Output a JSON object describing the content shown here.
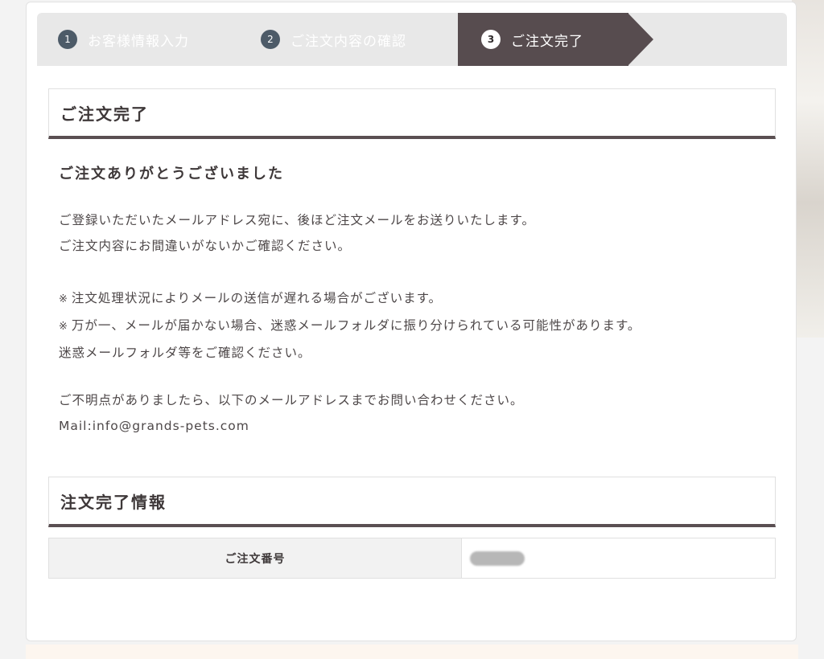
{
  "stepper": {
    "steps": [
      {
        "num": "1",
        "label": "お客様情報入力"
      },
      {
        "num": "2",
        "label": "ご注文内容の確認"
      },
      {
        "num": "3",
        "label": "ご注文完了"
      }
    ]
  },
  "complete_section": {
    "title": "ご注文完了",
    "thanks": "ご注文ありがとうございました",
    "lines": [
      "ご登録いただいたメールアドレス宛に、後ほど注文メールをお送りいたします。",
      "ご注文内容にお間違いがないかご確認ください。"
    ],
    "note_mark": "※",
    "notes": [
      "注文処理状況によりメールの送信が遅れる場合がございます。",
      "万が一、メールが届かない場合、迷惑メールフォルダに振り分けられている可能性があります。"
    ],
    "notes_tail": "迷惑メールフォルダ等をご確認ください。",
    "contact_line": "ご不明点がありましたら、以下のメールアドレスまでお問い合わせください。",
    "mail": "Mail:info@grands-pets.com"
  },
  "info_section": {
    "title": "注文完了情報",
    "order_number_label": "ご注文番号"
  }
}
